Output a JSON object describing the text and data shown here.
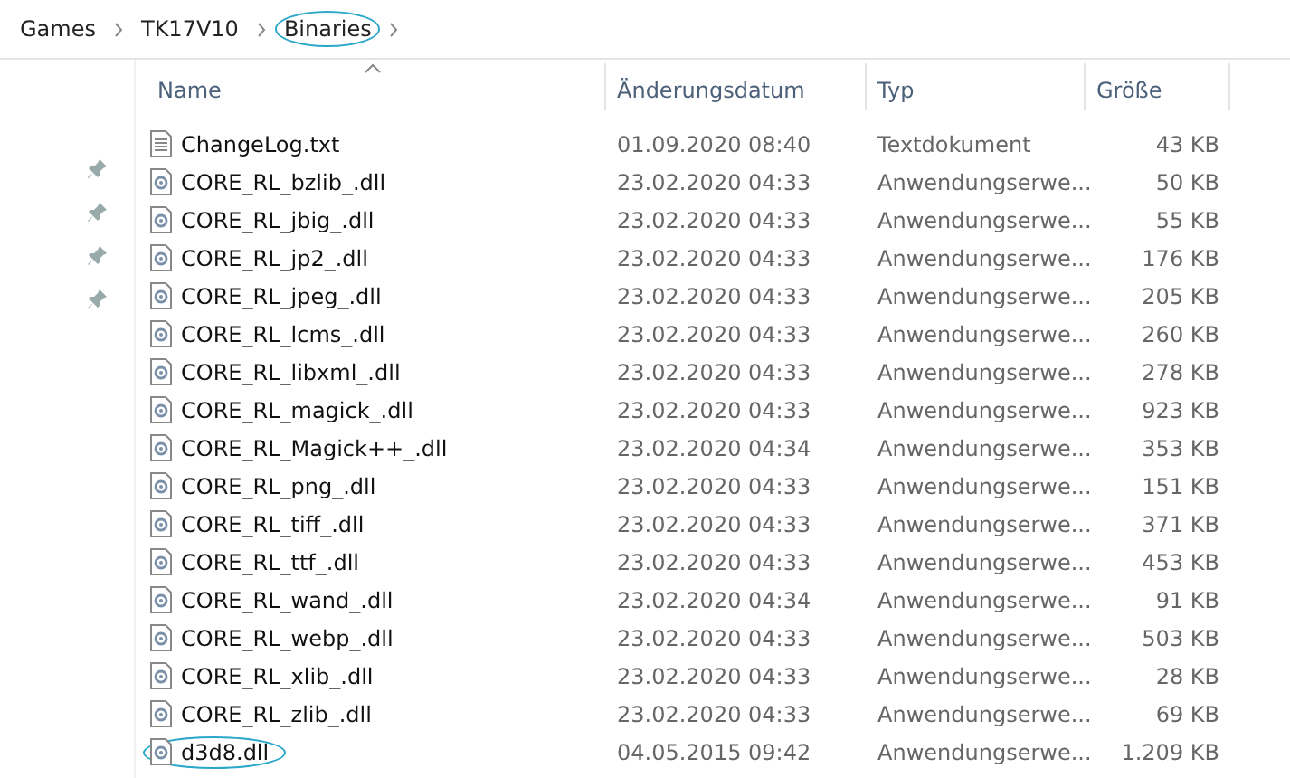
{
  "breadcrumb": [
    {
      "label": "Games",
      "circled": false
    },
    {
      "label": "TK17V10",
      "circled": false
    },
    {
      "label": "Binaries",
      "circled": true
    }
  ],
  "table": {
    "columns": [
      "Name",
      "Änderungsdatum",
      "Typ",
      "Größe"
    ],
    "rows": [
      {
        "name": "ChangeLog.txt",
        "date": "01.09.2020 08:40",
        "type": "Textdokument",
        "size": "43 KB",
        "kind": "text",
        "circled": false
      },
      {
        "name": "CORE_RL_bzlib_.dll",
        "date": "23.02.2020 04:33",
        "type": "Anwendungserwe...",
        "size": "50 KB",
        "kind": "dll",
        "circled": false
      },
      {
        "name": "CORE_RL_jbig_.dll",
        "date": "23.02.2020 04:33",
        "type": "Anwendungserwe...",
        "size": "55 KB",
        "kind": "dll",
        "circled": false
      },
      {
        "name": "CORE_RL_jp2_.dll",
        "date": "23.02.2020 04:33",
        "type": "Anwendungserwe...",
        "size": "176 KB",
        "kind": "dll",
        "circled": false
      },
      {
        "name": "CORE_RL_jpeg_.dll",
        "date": "23.02.2020 04:33",
        "type": "Anwendungserwe...",
        "size": "205 KB",
        "kind": "dll",
        "circled": false
      },
      {
        "name": "CORE_RL_lcms_.dll",
        "date": "23.02.2020 04:33",
        "type": "Anwendungserwe...",
        "size": "260 KB",
        "kind": "dll",
        "circled": false
      },
      {
        "name": "CORE_RL_libxml_.dll",
        "date": "23.02.2020 04:33",
        "type": "Anwendungserwe...",
        "size": "278 KB",
        "kind": "dll",
        "circled": false
      },
      {
        "name": "CORE_RL_magick_.dll",
        "date": "23.02.2020 04:33",
        "type": "Anwendungserwe...",
        "size": "923 KB",
        "kind": "dll",
        "circled": false
      },
      {
        "name": "CORE_RL_Magick++_.dll",
        "date": "23.02.2020 04:34",
        "type": "Anwendungserwe...",
        "size": "353 KB",
        "kind": "dll",
        "circled": false
      },
      {
        "name": "CORE_RL_png_.dll",
        "date": "23.02.2020 04:33",
        "type": "Anwendungserwe...",
        "size": "151 KB",
        "kind": "dll",
        "circled": false
      },
      {
        "name": "CORE_RL_tiff_.dll",
        "date": "23.02.2020 04:33",
        "type": "Anwendungserwe...",
        "size": "371 KB",
        "kind": "dll",
        "circled": false
      },
      {
        "name": "CORE_RL_ttf_.dll",
        "date": "23.02.2020 04:33",
        "type": "Anwendungserwe...",
        "size": "453 KB",
        "kind": "dll",
        "circled": false
      },
      {
        "name": "CORE_RL_wand_.dll",
        "date": "23.02.2020 04:34",
        "type": "Anwendungserwe...",
        "size": "91 KB",
        "kind": "dll",
        "circled": false
      },
      {
        "name": "CORE_RL_webp_.dll",
        "date": "23.02.2020 04:33",
        "type": "Anwendungserwe...",
        "size": "503 KB",
        "kind": "dll",
        "circled": false
      },
      {
        "name": "CORE_RL_xlib_.dll",
        "date": "23.02.2020 04:33",
        "type": "Anwendungserwe...",
        "size": "28 KB",
        "kind": "dll",
        "circled": false
      },
      {
        "name": "CORE_RL_zlib_.dll",
        "date": "23.02.2020 04:33",
        "type": "Anwendungserwe...",
        "size": "69 KB",
        "kind": "dll",
        "circled": false
      },
      {
        "name": "d3d8.dll",
        "date": "04.05.2015 09:42",
        "type": "Anwendungserwe...",
        "size": "1.209 KB",
        "kind": "dll",
        "circled": true
      }
    ]
  }
}
